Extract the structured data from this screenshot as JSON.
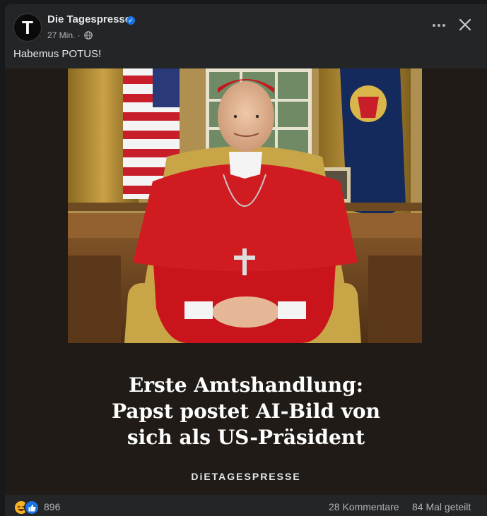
{
  "post": {
    "page_name": "Die Tagespresse",
    "avatar_letter": "T",
    "timestamp": "27 Min. ·",
    "text": "Habemus POTUS!"
  },
  "media": {
    "headline_lines": [
      "Erste Amtshandlung:",
      "Papst postet AI-Bild von",
      "sich als US-Präsident"
    ],
    "brand": "DiETAGESPRESSE"
  },
  "footer": {
    "reaction_count": "896",
    "comments": "28 Kommentare",
    "shares": "84 Mal geteilt"
  },
  "icons": {
    "verified": "verified-badge-icon",
    "audience": "globe-icon",
    "more": "more-horizontal-icon",
    "close": "close-icon",
    "reactions": [
      "haha-reaction-icon",
      "like-reaction-icon"
    ]
  },
  "colors": {
    "card_bg": "#242526",
    "text_primary": "#e4e6eb",
    "text_secondary": "#b0b3b8",
    "accent_blue": "#1b74e4",
    "robe_red": "#c8141a"
  }
}
